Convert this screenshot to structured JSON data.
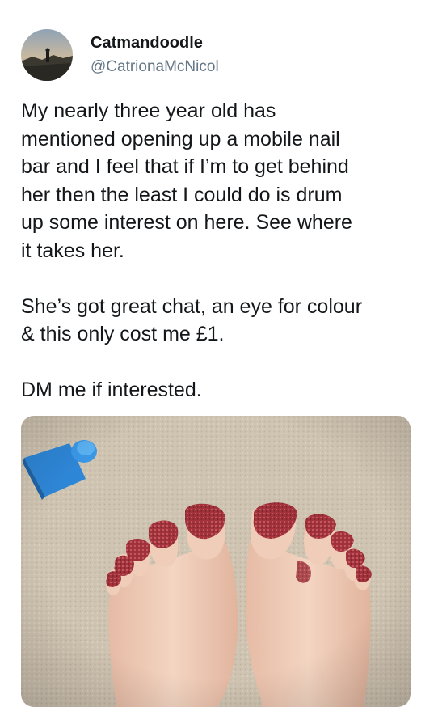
{
  "user": {
    "display_name": "Catmandoodle",
    "handle": "@CatrionaMcNicol",
    "avatar_icon": "profile-photo-icon"
  },
  "tweet": {
    "paragraphs": [
      "My nearly three year old has\nmentioned opening up a mobile nail\nbar and I feel that if I’m to get behind\nher then the least I could do is drum\nup some interest on here.  See where\nit takes her.",
      "She’s got great chat, an eye for colour\n& this only cost me £1.",
      "DM me if interested."
    ]
  },
  "media": {
    "icon": "feet-photo-icon",
    "colors": {
      "carpet": "#cfc3b1",
      "toy_block": "#2e86d6",
      "skin": "#f0cdb8",
      "glitter_polish": "#a2333c"
    }
  }
}
